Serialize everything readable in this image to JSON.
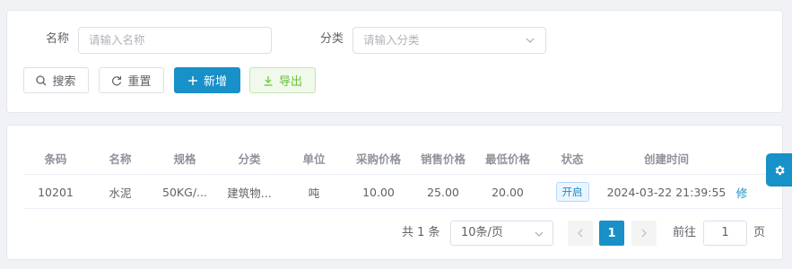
{
  "search": {
    "name_label": "名称",
    "name_placeholder": "请输入名称",
    "category_label": "分类",
    "category_placeholder": "请输入分类",
    "buttons": {
      "search": "搜索",
      "reset": "重置",
      "add": "新增",
      "export": "导出"
    }
  },
  "table": {
    "columns": [
      "条码",
      "名称",
      "规格",
      "分类",
      "单位",
      "采购价格",
      "销售价格",
      "最低价格",
      "状态",
      "创建时间"
    ],
    "rows": [
      {
        "barcode": "10201",
        "name": "水泥",
        "spec": "50KG/...",
        "category": "建筑物...",
        "unit": "吨",
        "purchase_price": "10.00",
        "sale_price": "25.00",
        "min_price": "20.00",
        "status": "开启",
        "created_at": "2024-03-22 21:39:55",
        "action": "修"
      }
    ]
  },
  "pagination": {
    "total_text": "共 1 条",
    "page_size": "10条/页",
    "current_page": "1",
    "goto_label": "前往",
    "goto_value": "1",
    "page_suffix": "页"
  },
  "colors": {
    "primary": "#1890c8",
    "export_green": "#67c23a",
    "status_tag": "#1890c8"
  },
  "icons": {
    "search": "search-icon",
    "reset": "refresh-icon",
    "add": "plus-icon",
    "export": "download-icon",
    "settings": "gear-icon"
  }
}
